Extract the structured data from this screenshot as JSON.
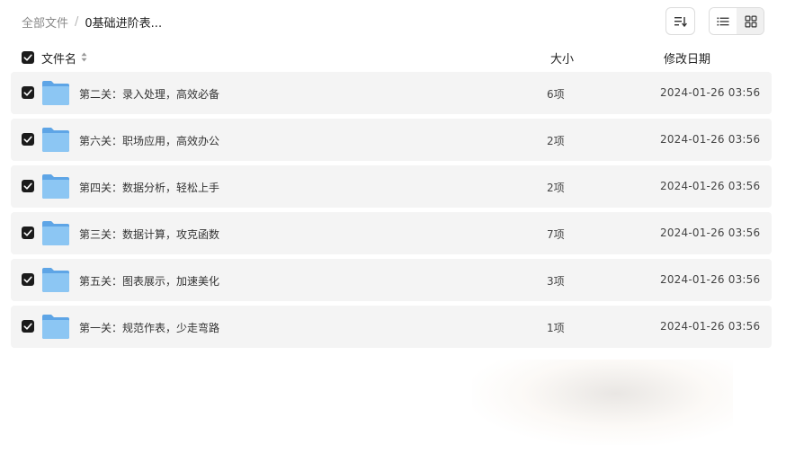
{
  "breadcrumb": {
    "root": "全部文件",
    "separator": "/",
    "current": "0基础进阶表..."
  },
  "toolbar": {
    "sort_icon": "sort-descending-icon",
    "list_view_icon": "list-view-icon",
    "grid_view_icon": "grid-view-icon",
    "active_view": "grid"
  },
  "table": {
    "columns": {
      "name": "文件名",
      "size": "大小",
      "date": "修改日期"
    },
    "rows": [
      {
        "name": "第二关：录入处理，高效必备",
        "size": "6项",
        "date": "2024-01-26 03:56"
      },
      {
        "name": "第六关：职场应用，高效办公",
        "size": "2项",
        "date": "2024-01-26 03:56"
      },
      {
        "name": "第四关：数据分析，轻松上手",
        "size": "2项",
        "date": "2024-01-26 03:56"
      },
      {
        "name": "第三关：数据计算，攻克函数",
        "size": "7项",
        "date": "2024-01-26 03:56"
      },
      {
        "name": "第五关：图表展示，加速美化",
        "size": "3项",
        "date": "2024-01-26 03:56"
      },
      {
        "name": "第一关：规范作表，少走弯路",
        "size": "1项",
        "date": "2024-01-26 03:56"
      }
    ]
  },
  "colors": {
    "row_background": "#f4f4f4",
    "checkbox": "#1b1b1b",
    "folder": "#7cb8ec"
  }
}
